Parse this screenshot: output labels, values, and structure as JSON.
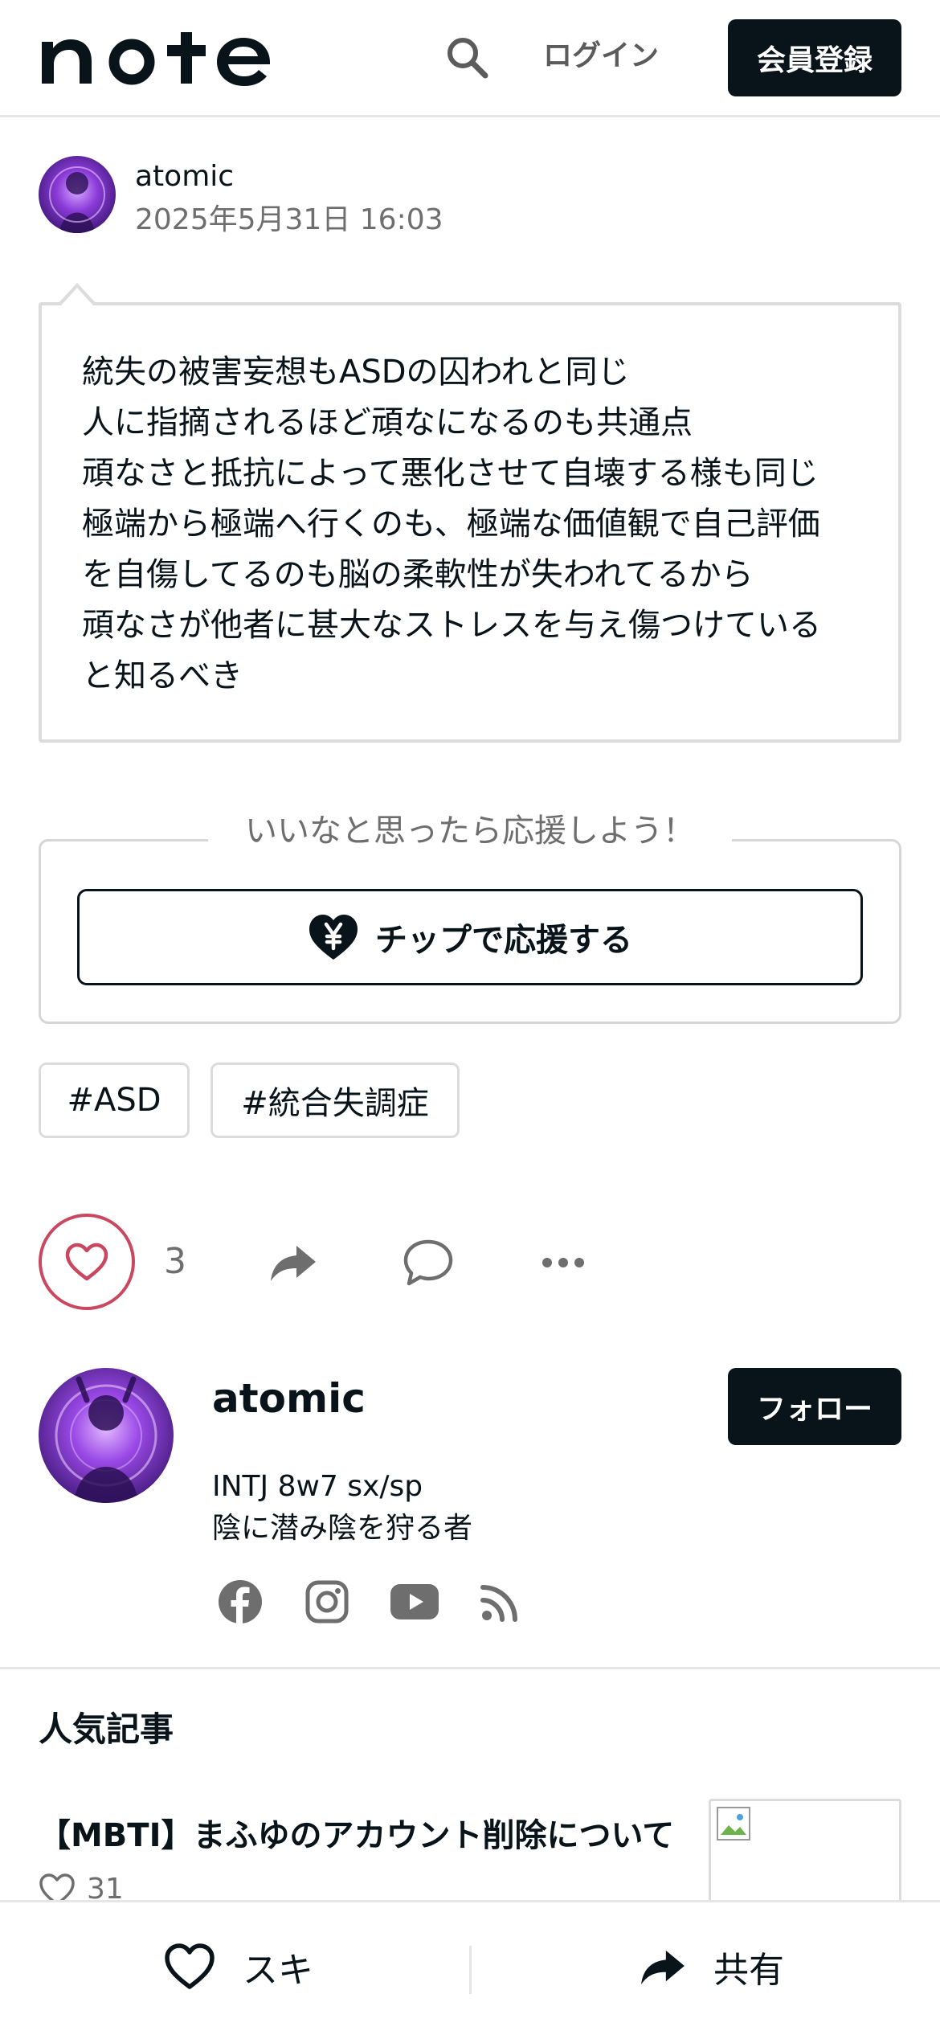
{
  "header": {
    "logo_text": "note",
    "login_label": "ログイン",
    "signup_label": "会員登録"
  },
  "post": {
    "author_name": "atomic",
    "date": "2025年5月31日 16:03",
    "lines": [
      "統失の被害妄想もASDの囚われと同じ",
      "人に指摘されるほど頑なになるのも共通点",
      "頑なさと抵抗によって悪化させて自壊する様も同じ",
      "極端から極端へ行くのも、極端な価値観で自己評価",
      "を自傷してるのも脳の柔軟性が失われてるから",
      "頑なさが他者に甚大なストレスを与え傷つけている",
      "と知るべき"
    ]
  },
  "support": {
    "caption": "いいなと思ったら応援しよう！",
    "tip_button_label": "チップで応援する"
  },
  "tags": [
    "#ASD",
    "#統合失調症"
  ],
  "actions": {
    "like_count": "3"
  },
  "profile": {
    "name": "atomic",
    "bio_lines": [
      "INTJ 8w7 sx/sp",
      "陰に潜み陰を狩る者"
    ],
    "follow_label": "フォロー",
    "social_icons": [
      "facebook-icon",
      "instagram-icon",
      "youtube-icon",
      "rss-icon"
    ]
  },
  "popular": {
    "heading": "人気記事",
    "articles": [
      {
        "title": "【MBTI】まふゆのアカウント削除について",
        "likes": "31"
      }
    ]
  },
  "bottom_bar": {
    "like_label": "スキ",
    "share_label": "共有"
  },
  "colors": {
    "ink": "#08131a",
    "like_accent": "#c9475f",
    "muted": "#6e6e6e",
    "avatar_purple": "#8a3ad8"
  }
}
